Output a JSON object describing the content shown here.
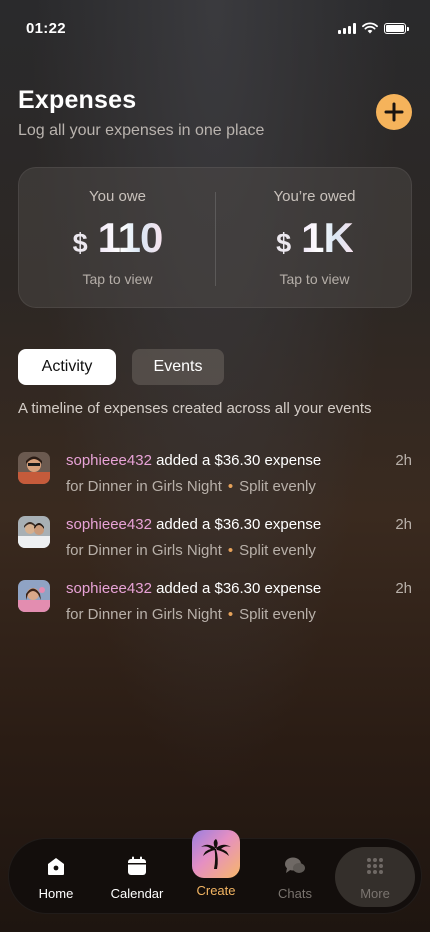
{
  "status": {
    "time": "01:22"
  },
  "header": {
    "title": "Expenses",
    "subtitle": "Log all your expenses in one place"
  },
  "summary": {
    "owe": {
      "label": "You owe",
      "currency": "$",
      "amount": "110",
      "hint": "Tap to view"
    },
    "owed": {
      "label": "You’re owed",
      "currency": "$",
      "amount": "1K",
      "hint": "Tap to view"
    }
  },
  "tabs": [
    {
      "label": "Activity",
      "active": true
    },
    {
      "label": "Events",
      "active": false
    }
  ],
  "timeline_description": "A timeline of expenses created across all your events",
  "activities": [
    {
      "user": "sophieee432",
      "action": "added a $36.30 expense",
      "event": "for Dinner in Girls Night",
      "split": "Split evenly",
      "time": "2h"
    },
    {
      "user": "sophieee432",
      "action": "added a $36.30 expense",
      "event": "for Dinner in Girls Night",
      "split": "Split evenly",
      "time": "2h"
    },
    {
      "user": "sophieee432",
      "action": "added a $36.30 expense",
      "event": "for Dinner in Girls Night",
      "split": "Split evenly",
      "time": "2h"
    }
  ],
  "nav": {
    "home": {
      "label": "Home",
      "icon": "home-icon"
    },
    "calendar": {
      "label": "Calendar",
      "icon": "calendar-icon"
    },
    "create": {
      "label": "Create",
      "icon": "palm-tree-icon"
    },
    "chats": {
      "label": "Chats",
      "icon": "chat-bubbles-icon"
    },
    "more": {
      "label": "More",
      "icon": "grid-dots-icon"
    }
  },
  "colors": {
    "accent": "#f5b35b",
    "username": "#e7a2d6",
    "dot": "#e6a25a"
  }
}
